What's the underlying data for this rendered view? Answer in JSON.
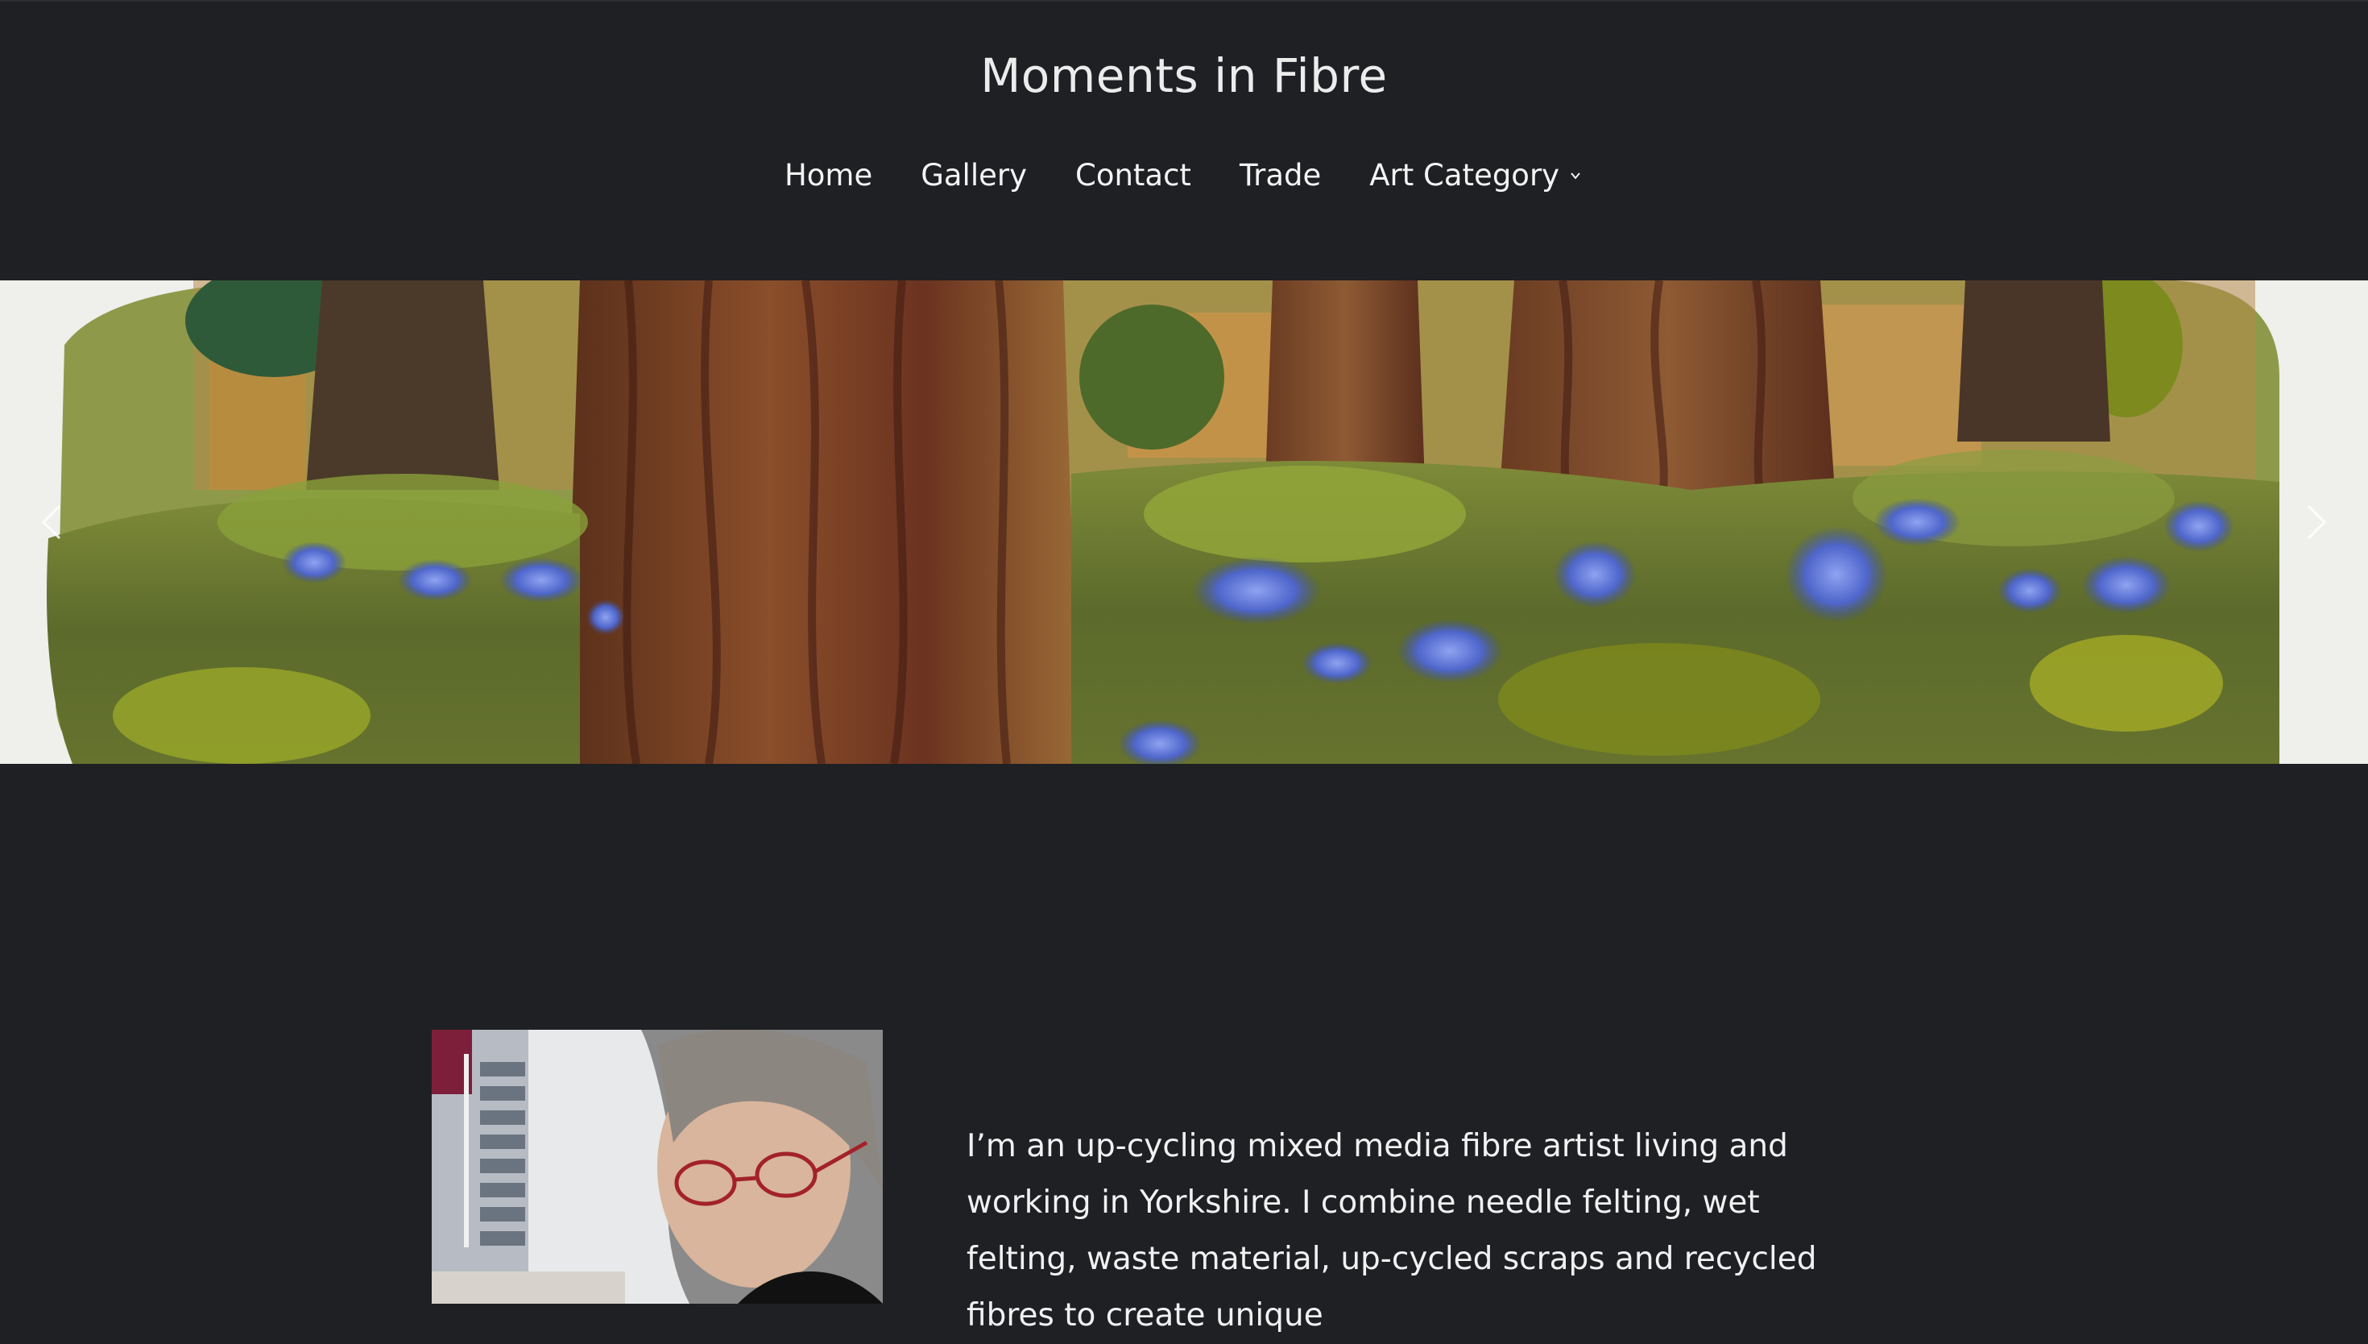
{
  "site": {
    "title": "Moments in Fibre"
  },
  "nav": {
    "items": [
      {
        "label": "Home"
      },
      {
        "label": "Gallery"
      },
      {
        "label": "Contact"
      },
      {
        "label": "Trade"
      },
      {
        "label": "Art Category",
        "has_dropdown": true
      }
    ]
  },
  "hero": {
    "prev_icon": "chevron-left-icon",
    "next_icon": "chevron-right-icon"
  },
  "about": {
    "text": "I’m an up-cycling mixed media fibre artist living and working in Yorkshire. I combine needle felting, wet felting, waste material, up-cycled scraps and recycled fibres to create unique"
  },
  "colors": {
    "background": "#1f2024",
    "text": "#f2f2f2"
  }
}
